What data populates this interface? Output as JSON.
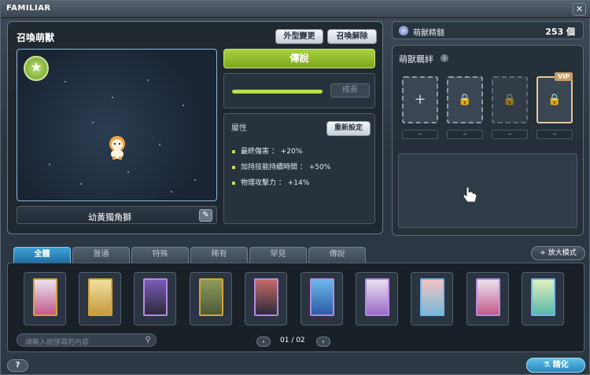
{
  "window": {
    "title": "FAMILIAR"
  },
  "summon": {
    "section_title": "召喚萌獸",
    "change_appearance_label": "外型變更",
    "release_label": "召喚解除",
    "familiar_name": "幼黃獨角獅",
    "rank": "傳說",
    "grow_label": "成長",
    "growth_progress_percent": 100,
    "attributes_title": "屬性",
    "reset_label": "重新設定",
    "attributes": [
      "最終傷害 ： +20%",
      "加持技能持續時間 ： +50%",
      "物理攻擊力 ： +14%"
    ]
  },
  "essence": {
    "label": "萌獸精髓",
    "value": "253 個"
  },
  "bond": {
    "title": "萌獸羈絆",
    "vip_tag": "VIP",
    "slot_values": [
      "–",
      "–",
      "–",
      "–"
    ]
  },
  "tabs": [
    "全體",
    "普通",
    "特殊",
    "稀有",
    "罕見",
    "傳說"
  ],
  "active_tab": "全體",
  "zoom_label": "+ 放大模式",
  "search": {
    "placeholder": "請輸入欲搜尋的內容"
  },
  "pager": {
    "text": "01 / 02"
  },
  "help_label": "?",
  "refine_label": "精化",
  "colors": {
    "accent_green": "#8fbb2a",
    "tab_active": "#2a84bd"
  }
}
